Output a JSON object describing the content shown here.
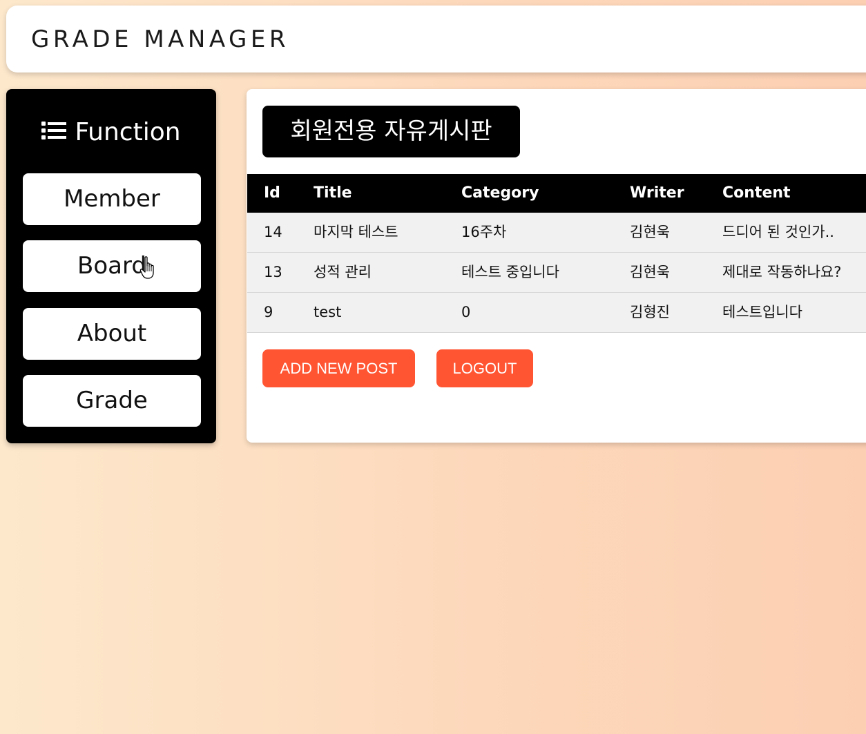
{
  "header": {
    "app_title": "GRADE MANAGER"
  },
  "sidebar": {
    "heading": "Function",
    "heading_icon": "list-icon",
    "items": [
      {
        "label": "Member"
      },
      {
        "label": "Board"
      },
      {
        "label": "About"
      },
      {
        "label": "Grade"
      }
    ]
  },
  "main": {
    "board_title": "회원전용 자유게시판",
    "table": {
      "columns": [
        "Id",
        "Title",
        "Category",
        "Writer",
        "Content"
      ],
      "rows": [
        {
          "id": "14",
          "title": "마지막 테스트",
          "category": "16주차",
          "writer": "김현욱",
          "content": "드디어 된 것인가.."
        },
        {
          "id": "13",
          "title": "성적 관리",
          "category": "테스트 중입니다",
          "writer": "김현욱",
          "content": "제대로 작동하나요?"
        },
        {
          "id": "9",
          "title": "test",
          "category": "0",
          "writer": "김형진",
          "content": "테스트입니다"
        }
      ]
    },
    "actions": {
      "add_post_label": "ADD NEW POST",
      "logout_label": "LOGOUT"
    }
  },
  "colors": {
    "accent": "#ff5533",
    "sidebar_bg": "#000000",
    "row_bg": "#f1f1f1"
  }
}
